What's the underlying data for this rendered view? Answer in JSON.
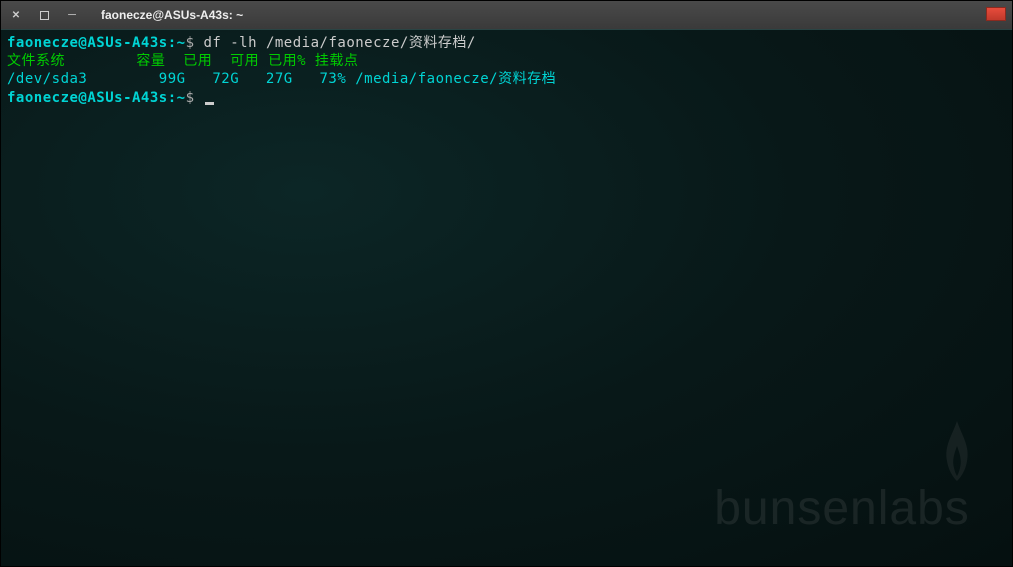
{
  "titlebar": {
    "title": "faonecze@ASUs-A43s: ~"
  },
  "terminal": {
    "prompt_user_host": "faonecze@ASUs-A43s",
    "prompt_path": "~",
    "command1": "df -lh /media/faonecze/资料存档/",
    "header": "文件系统        容量  已用  可用 已用% 挂载点",
    "data_row": "/dev/sda3        99G   72G   27G   73% /media/faonecze/资料存档"
  },
  "watermark": {
    "text": "bunsenlabs"
  }
}
